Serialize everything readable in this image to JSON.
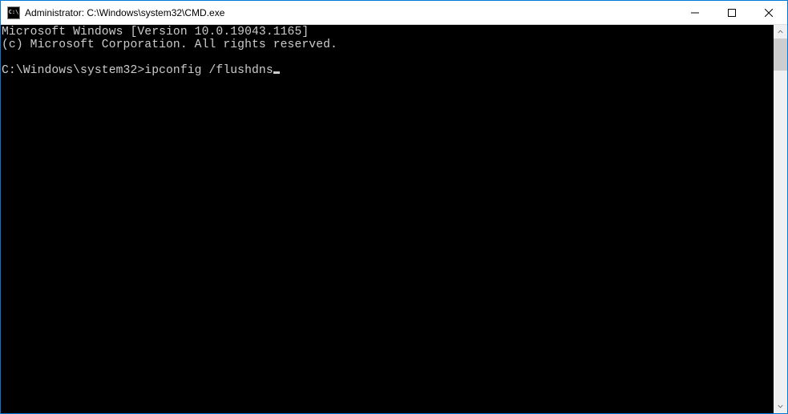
{
  "window": {
    "title": "Administrator: C:\\Windows\\system32\\CMD.exe",
    "icon_label": "C:\\"
  },
  "terminal": {
    "line1": "Microsoft Windows [Version 10.0.19043.1165]",
    "line2": "(c) Microsoft Corporation. All rights reserved.",
    "blank": "",
    "prompt": "C:\\Windows\\system32>",
    "command": "ipconfig /flushdns"
  }
}
